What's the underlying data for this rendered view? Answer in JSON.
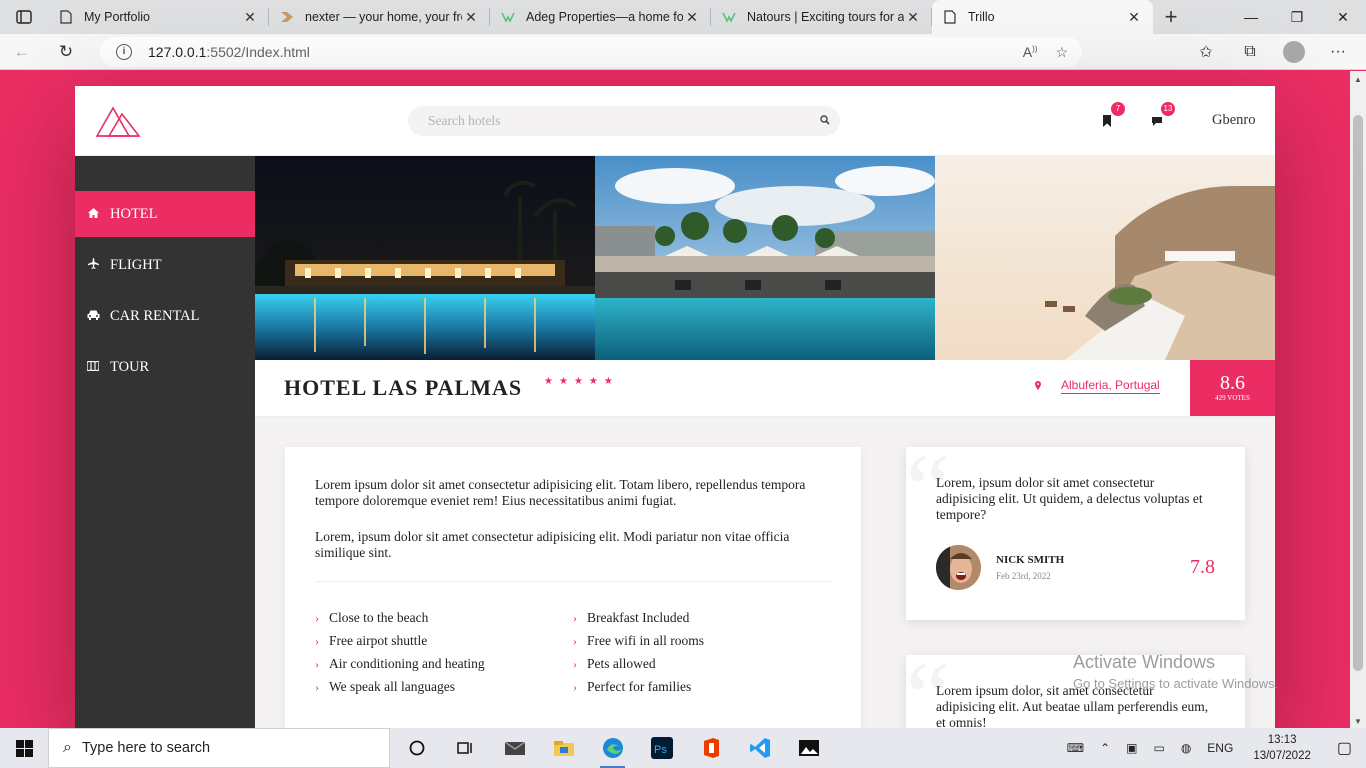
{
  "browser": {
    "tabs": [
      {
        "title": "My Portfolio",
        "active": false
      },
      {
        "title": "nexter — your home, your fre",
        "active": false
      },
      {
        "title": "Adeg Properties—a home for",
        "active": false
      },
      {
        "title": "Natours | Exciting tours for ac",
        "active": false
      },
      {
        "title": "Trillo",
        "active": true
      }
    ],
    "url_host": "127.0.0.1",
    "url_rest": ":5502/Index.html"
  },
  "header": {
    "search_placeholder": "Search hotels",
    "bookmarks_count": "7",
    "messages_count": "13",
    "user_name": "Gbenro"
  },
  "sidebar": {
    "items": [
      {
        "label": "HOTEL",
        "icon": "home-icon",
        "active": true
      },
      {
        "label": "FLIGHT",
        "icon": "plane-icon",
        "active": false
      },
      {
        "label": "CAR RENTAL",
        "icon": "car-icon",
        "active": false
      },
      {
        "label": "TOUR",
        "icon": "map-icon",
        "active": false
      }
    ]
  },
  "hotel": {
    "name": "HOTEL LAS PALMAS",
    "stars": 5,
    "location": "Albuferia, Portugal",
    "rating": "8.6",
    "votes": "429 VOTES"
  },
  "description": {
    "paragraph1": "Lorem ipsum dolor sit amet consectetur adipisicing elit. Totam libero, repellendus tempora tempore doloremque eveniet rem! Eius necessitatibus animi fugiat.",
    "paragraph2": "Lorem, ipsum dolor sit amet consectetur adipisicing elit. Modi pariatur non vitae officia similique sint.",
    "features": [
      "Close to the beach",
      "Breakfast Included",
      "Free airpot shuttle",
      "Free wifi in all rooms",
      "Air conditioning and heating",
      "Pets allowed",
      "We speak all languages",
      "Perfect for families"
    ]
  },
  "reviews": [
    {
      "text": "Lorem, ipsum dolor sit amet consectetur adipisicing elit. Ut quidem, a delectus voluptas et tempore?",
      "name": "NICK SMITH",
      "date": "Feb 23rd, 2022",
      "score": "7.8"
    },
    {
      "text": "Lorem ipsum dolor, sit amet consectetur adipisicing elit. Aut beatae ullam perferendis eum, et omnis!"
    }
  ],
  "watermark": {
    "line1": "Activate Windows",
    "line2": "Go to Settings to activate Windows."
  },
  "taskbar": {
    "search_placeholder": "Type here to search",
    "language": "ENG",
    "time": "13:13",
    "date": "13/07/2022"
  },
  "colors": {
    "primary": "#ec2d64",
    "sidebar": "#333333",
    "background": "#f4f2f2"
  }
}
